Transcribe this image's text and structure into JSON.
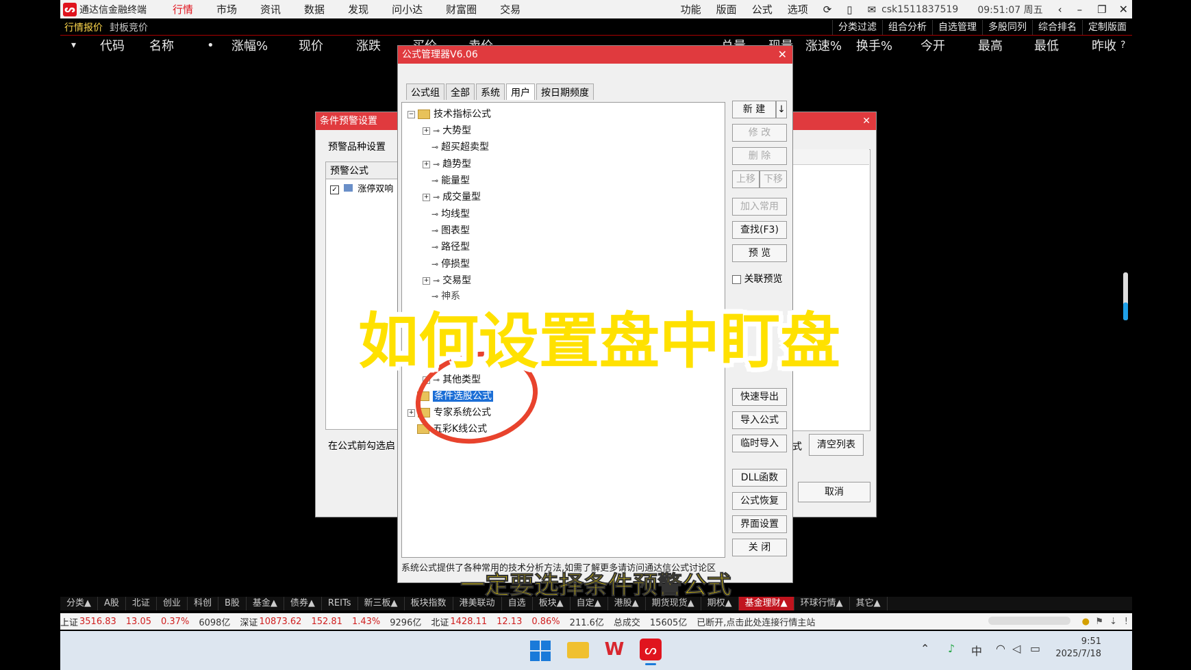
{
  "app": {
    "name": "通达信金融终端",
    "menus": [
      "行情",
      "市场",
      "资讯",
      "数据",
      "发现",
      "问小达",
      "财富圈",
      "交易"
    ],
    "right_menus": [
      "功能",
      "版面",
      "公式",
      "选项"
    ],
    "account": "csk1511837519",
    "clock": "09:51:07 周五",
    "subbar_left": [
      "行情报价",
      "封板竞价"
    ],
    "subbar_right": [
      "分类过滤",
      "组合分析",
      "自选管理",
      "多股同列",
      "综合排名",
      "定制版面"
    ],
    "columns": [
      "代码",
      "名称",
      "•",
      "涨幅%",
      "现价",
      "涨跌",
      "买价",
      "卖价",
      "总量",
      "现量",
      "涨速%",
      "换手%",
      "今开",
      "最高",
      "最低",
      "昨收"
    ]
  },
  "alert_dialog": {
    "title": "条件预警设置",
    "section_label": "预警品种设置",
    "list_header": "预警公式",
    "list_item": "涨停双响",
    "footer_text": "在公式前勾选启",
    "clear_button": "清空列表",
    "cancel_button": "取消",
    "partial_text": "式"
  },
  "formula_manager": {
    "title": "公式管理器V6.06",
    "tabs": [
      "公式组",
      "全部",
      "系统",
      "用户",
      "按日期频度"
    ],
    "tree": {
      "root": "技术指标公式",
      "children": [
        "大势型",
        "超买超卖型",
        "趋势型",
        "能量型",
        "成交量型",
        "均线型",
        "图表型",
        "路径型",
        "停损型",
        "交易型",
        "神系",
        "其他类型"
      ],
      "selected": "条件选股公式",
      "expert": "专家系统公式",
      "last": "五彩K线公式"
    },
    "buttons": {
      "new": "新 建",
      "modify": "修 改",
      "delete": "删 除",
      "up": "上移",
      "down": "下移",
      "add_common": "加入常用",
      "find": "查找(F3)",
      "preview": "预 览",
      "link_preview": "关联预览",
      "quick_export": "快速导出",
      "import": "导入公式",
      "temp_import": "临时导入",
      "dll": "DLL函数",
      "restore": "公式恢复",
      "ui_settings": "界面设置",
      "close": "关 闭"
    },
    "status": "系统公式提供了各种常用的技术分析方法,如需了解更多请访问通达信公式讨论区"
  },
  "overlay": {
    "headline": "如何设置盘中盯盘",
    "subtitle": "一定要选择条件预警公式"
  },
  "sector_tabs": [
    "分类▲",
    "A股",
    "北证",
    "创业",
    "科创",
    "B股",
    "基金▲",
    "债券▲",
    "REITs",
    "新三板▲",
    "板块指数",
    "港美联动",
    "自选",
    "板块▲",
    "自定▲",
    "港股▲",
    "期货现货▲",
    "期权▲",
    "基金理财▲",
    "环球行情▲",
    "其它▲"
  ],
  "sector_active": "基金理财▲",
  "index_bar": {
    "sh_label": "上证",
    "sh_value": "3516.83",
    "sh_change": "13.05",
    "sh_pct": "0.37%",
    "sh_amount": "6098亿",
    "sz_label": "深证",
    "sz_value": "10873.62",
    "sz_change": "152.81",
    "sz_pct": "1.43%",
    "sz_amount": "9296亿",
    "bz_label": "北证",
    "bz_value": "1428.11",
    "bz_change": "12.13",
    "bz_pct": "0.86%",
    "bz_amount": "211.6亿",
    "total_label": "总成交",
    "total_value": "15605亿",
    "notice": "已断开,点击此处连接行情主站"
  },
  "taskbar": {
    "time": "9:51",
    "date": "2025/7/18",
    "ime": "中"
  },
  "colors": {
    "brand_red": "#e0141e",
    "title_red": "#e03a3e",
    "highlight_yellow": "#ffe100",
    "select_blue": "#1b6ed6"
  }
}
